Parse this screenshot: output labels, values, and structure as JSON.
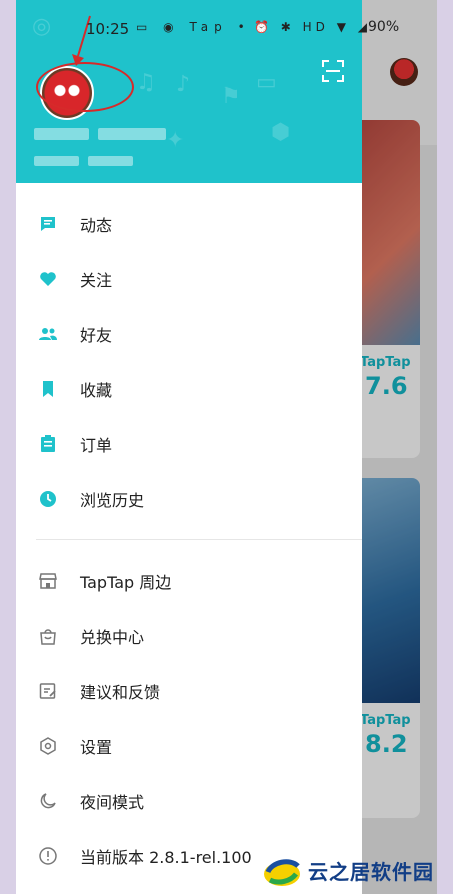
{
  "status_bar": {
    "time": "10:25",
    "left_icons": "▭ ◉ Tap •",
    "right_icons": "⏰ ✱ HD ▼ ◢",
    "battery": "90%"
  },
  "menu": {
    "primary": [
      {
        "label": "动态",
        "icon": "feed-icon"
      },
      {
        "label": "关注",
        "icon": "heart-icon"
      },
      {
        "label": "好友",
        "icon": "friends-icon"
      },
      {
        "label": "收藏",
        "icon": "bookmark-icon"
      },
      {
        "label": "订单",
        "icon": "order-icon"
      },
      {
        "label": "浏览历史",
        "icon": "clock-icon"
      }
    ],
    "secondary": [
      {
        "label": "TapTap 周边",
        "icon": "store-icon"
      },
      {
        "label": "兑换中心",
        "icon": "bag-icon"
      },
      {
        "label": "建议和反馈",
        "icon": "feedback-icon"
      },
      {
        "label": "设置",
        "icon": "settings-icon"
      },
      {
        "label": "夜间模式",
        "icon": "moon-icon"
      },
      {
        "label": "当前版本 2.8.1-rel.100",
        "icon": "info-icon"
      }
    ]
  },
  "background": {
    "card1": {
      "brand": "TapTap",
      "score": "7.6"
    },
    "card2": {
      "brand": "TapTap",
      "score": "8.2"
    }
  },
  "watermark": {
    "text": "云之居软件园"
  },
  "colors": {
    "accent": "#1fc2cb",
    "annotation": "#d62a2a"
  }
}
